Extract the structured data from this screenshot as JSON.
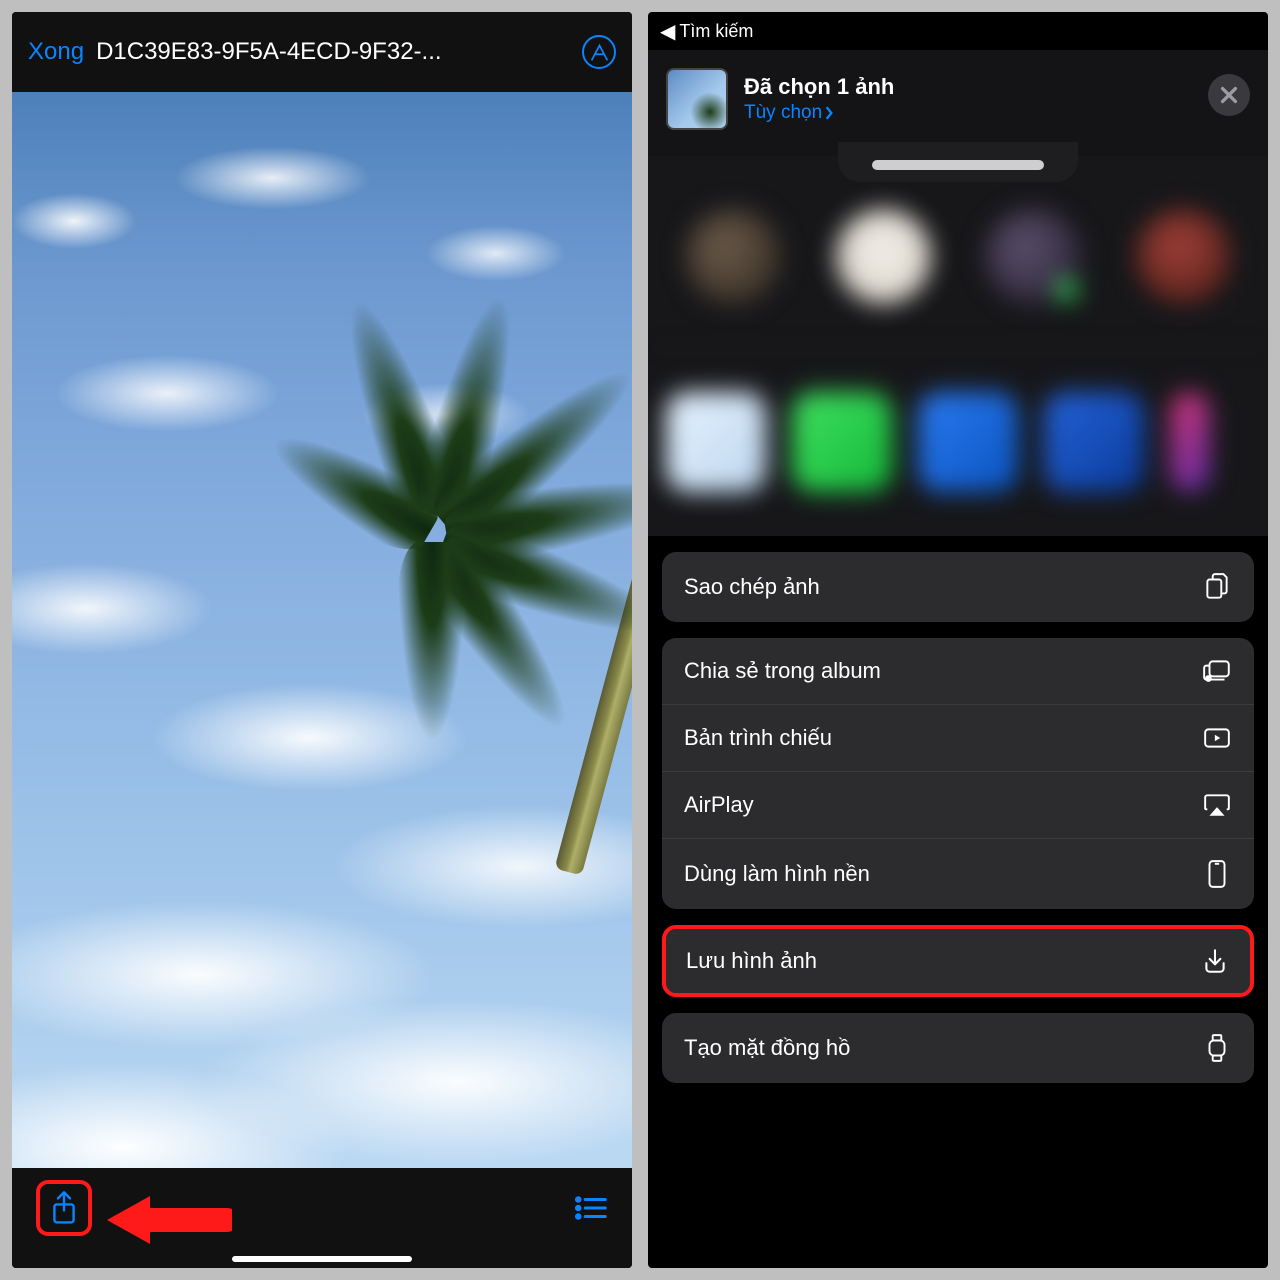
{
  "left": {
    "done_label": "Xong",
    "filename": "D1C39E83-9F5A-4ECD-9F32-..."
  },
  "right": {
    "back_label": "Tìm kiếm",
    "selected_title": "Đã chọn 1 ảnh",
    "options_label": "Tùy chọn",
    "actions": {
      "copy": "Sao chép ảnh",
      "share_album": "Chia sẻ trong album",
      "slideshow": "Bản trình chiếu",
      "airplay": "AirPlay",
      "wallpaper": "Dùng làm hình nền",
      "save": "Lưu hình ảnh",
      "watchface": "Tạo mặt đồng hồ"
    }
  }
}
